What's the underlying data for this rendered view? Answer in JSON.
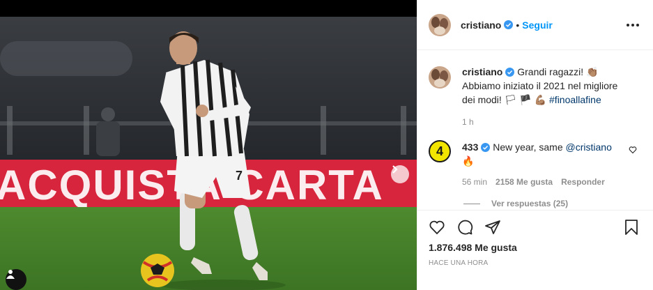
{
  "post": {
    "username": "cristiano",
    "follow_label": "Seguir",
    "separator": "•",
    "caption_line1": "Grandi ragazzi! 👏🏽",
    "caption_line2": "Abbiamo iniziato il 2021 nel migliore",
    "caption_line3": "dei modi! 🏳 🏴 💪🏽 ",
    "hashtag": "#finoallafine",
    "caption_time": "1 h",
    "likes": "1.876.498 Me gusta",
    "timestamp": "HACE UNA HORA"
  },
  "comment": {
    "username": "433",
    "avatar_text": "4",
    "text": "New year, same ",
    "mention": "@cristiano",
    "emoji": "🔥",
    "time": "56 min",
    "likes": "2158 Me gusta",
    "reply_label": "Responder",
    "view_replies": "Ver respuestas (25)"
  },
  "photo": {
    "banner_text": "ACQUISTA  CARTA",
    "jersey_number": "7"
  },
  "carousel": {
    "count": 7,
    "active_index": 0
  },
  "colors": {
    "link": "#0095f6",
    "verified": "#3897f0",
    "text": "#262626",
    "muted": "#8e8e8e",
    "banner": "#d6253c"
  },
  "icons": [
    "verified-icon",
    "more-options-icon",
    "heart-icon",
    "comment-icon",
    "share-icon",
    "bookmark-icon",
    "next-arrow-icon",
    "user-tag-icon"
  ]
}
